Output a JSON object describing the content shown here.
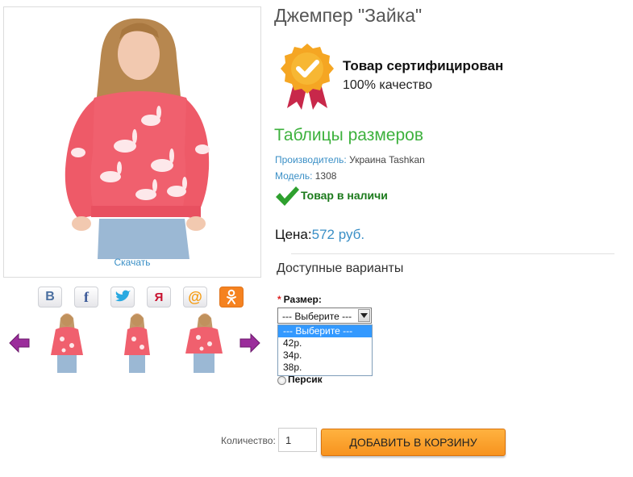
{
  "gallery": {
    "download_label": "Скачать",
    "share": [
      {
        "name": "vk-icon",
        "glyph": "В"
      },
      {
        "name": "facebook-icon",
        "glyph": "f"
      },
      {
        "name": "twitter-icon",
        "glyph": ""
      },
      {
        "name": "yandex-icon",
        "glyph": "Я"
      },
      {
        "name": "mail-icon",
        "glyph": "@"
      },
      {
        "name": "odnoklassniki-icon",
        "glyph": "ок"
      }
    ]
  },
  "product": {
    "title": "Джемпер \"Зайка\"",
    "certificate_title": "Товар сертифицирован",
    "certificate_subtitle": "100% качество",
    "size_table_link": "Таблицы размеров",
    "maker_label": "Производитель:",
    "maker_value": "Украина Tashkan",
    "model_label": "Модель:",
    "model_value": "1308",
    "stock_text": "Товар в наличи",
    "price_label": "Цена:",
    "price_value": "572 руб."
  },
  "options": {
    "title": "Доступные варианты",
    "size_label": "Размер:",
    "required_mark": "*",
    "size_selected": "--- Выберите ---",
    "size_options": [
      "--- Выберите ---",
      "42р.",
      "34р.",
      "38р."
    ],
    "color_option": "Персик"
  },
  "cart": {
    "qty_label": "Количество:",
    "qty_value": "1",
    "add_button": "ДОБАВИТЬ В КОРЗИНУ"
  },
  "colors": {
    "accent_blue": "#3a8fc6",
    "size_link_green": "#3db13d",
    "stock_green": "#1b7a1b",
    "sweater_pink": "#f0606e",
    "button_orange": "#f7931e",
    "arrow_purple": "#9b2d9b",
    "badge_gold": "#f5a623",
    "ribbon_red": "#c8284a"
  }
}
